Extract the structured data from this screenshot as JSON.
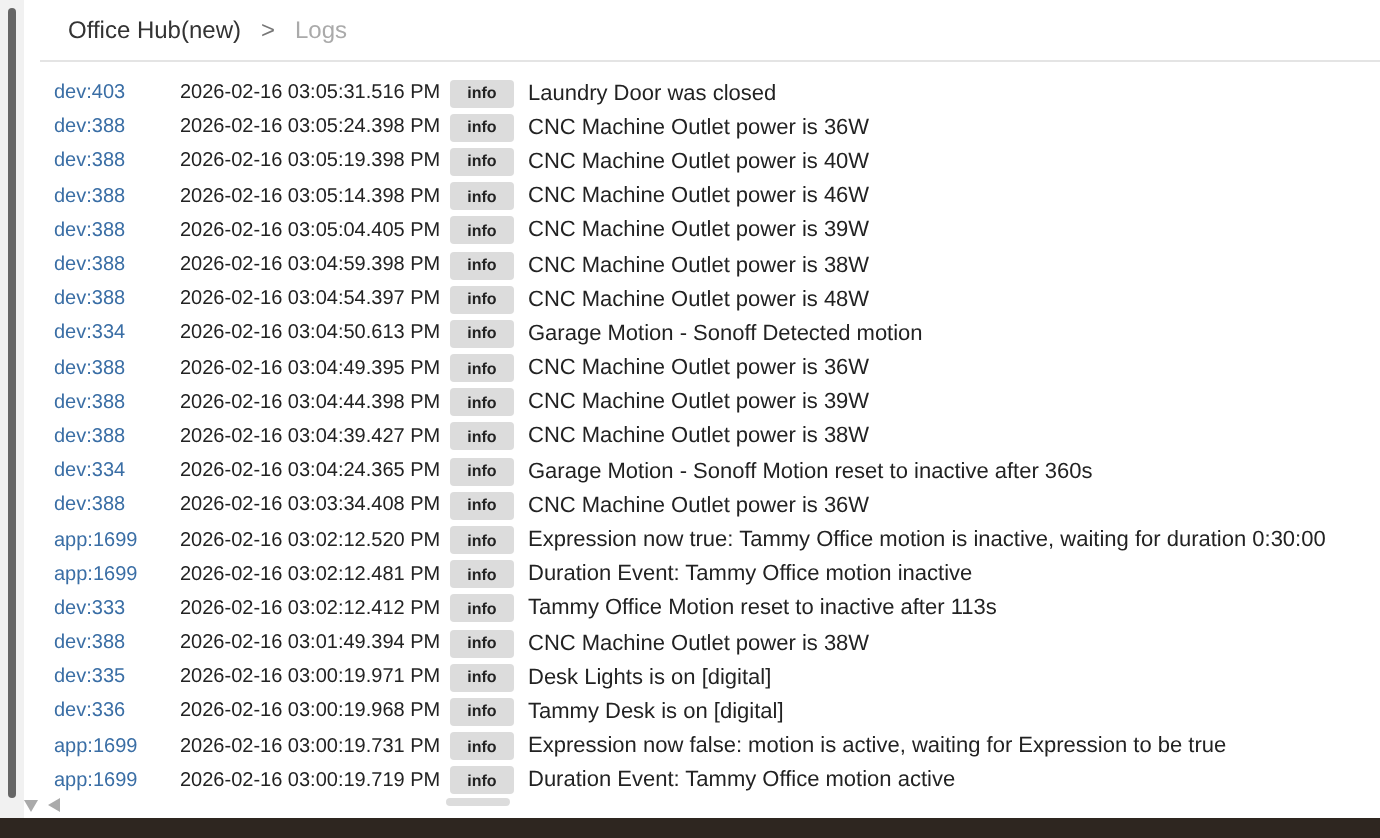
{
  "breadcrumb": {
    "parent": "Office Hub(new)",
    "separator": ">",
    "current": "Logs"
  },
  "logs": [
    {
      "source": "dev:403",
      "time": "2026-02-16 03:05:31.516 PM",
      "level": "info",
      "message": "Laundry Door was closed"
    },
    {
      "source": "dev:388",
      "time": "2026-02-16 03:05:24.398 PM",
      "level": "info",
      "message": "CNC Machine Outlet power is 36W"
    },
    {
      "source": "dev:388",
      "time": "2026-02-16 03:05:19.398 PM",
      "level": "info",
      "message": "CNC Machine Outlet power is 40W"
    },
    {
      "source": "dev:388",
      "time": "2026-02-16 03:05:14.398 PM",
      "level": "info",
      "message": "CNC Machine Outlet power is 46W"
    },
    {
      "source": "dev:388",
      "time": "2026-02-16 03:05:04.405 PM",
      "level": "info",
      "message": "CNC Machine Outlet power is 39W"
    },
    {
      "source": "dev:388",
      "time": "2026-02-16 03:04:59.398 PM",
      "level": "info",
      "message": "CNC Machine Outlet power is 38W"
    },
    {
      "source": "dev:388",
      "time": "2026-02-16 03:04:54.397 PM",
      "level": "info",
      "message": "CNC Machine Outlet power is 48W"
    },
    {
      "source": "dev:334",
      "time": "2026-02-16 03:04:50.613 PM",
      "level": "info",
      "message": "Garage Motion - Sonoff Detected motion"
    },
    {
      "source": "dev:388",
      "time": "2026-02-16 03:04:49.395 PM",
      "level": "info",
      "message": "CNC Machine Outlet power is 36W"
    },
    {
      "source": "dev:388",
      "time": "2026-02-16 03:04:44.398 PM",
      "level": "info",
      "message": "CNC Machine Outlet power is 39W"
    },
    {
      "source": "dev:388",
      "time": "2026-02-16 03:04:39.427 PM",
      "level": "info",
      "message": "CNC Machine Outlet power is 38W"
    },
    {
      "source": "dev:334",
      "time": "2026-02-16 03:04:24.365 PM",
      "level": "info",
      "message": "Garage Motion - Sonoff Motion reset to inactive after 360s"
    },
    {
      "source": "dev:388",
      "time": "2026-02-16 03:03:34.408 PM",
      "level": "info",
      "message": "CNC Machine Outlet power is 36W"
    },
    {
      "source": "app:1699",
      "time": "2026-02-16 03:02:12.520 PM",
      "level": "info",
      "message": "Expression now true: Tammy Office motion is inactive, waiting for duration 0:30:00"
    },
    {
      "source": "app:1699",
      "time": "2026-02-16 03:02:12.481 PM",
      "level": "info",
      "message": "Duration Event: Tammy Office motion inactive"
    },
    {
      "source": "dev:333",
      "time": "2026-02-16 03:02:12.412 PM",
      "level": "info",
      "message": "Tammy Office Motion reset to inactive after 113s"
    },
    {
      "source": "dev:388",
      "time": "2026-02-16 03:01:49.394 PM",
      "level": "info",
      "message": "CNC Machine Outlet power is 38W"
    },
    {
      "source": "dev:335",
      "time": "2026-02-16 03:00:19.971 PM",
      "level": "info",
      "message": "Desk Lights is on [digital]"
    },
    {
      "source": "dev:336",
      "time": "2026-02-16 03:00:19.968 PM",
      "level": "info",
      "message": "Tammy Desk is on [digital]"
    },
    {
      "source": "app:1699",
      "time": "2026-02-16 03:00:19.731 PM",
      "level": "info",
      "message": "Expression now false: motion is active, waiting for Expression to be true"
    },
    {
      "source": "app:1699",
      "time": "2026-02-16 03:00:19.719 PM",
      "level": "info",
      "message": "Duration Event: Tammy Office motion active"
    }
  ]
}
